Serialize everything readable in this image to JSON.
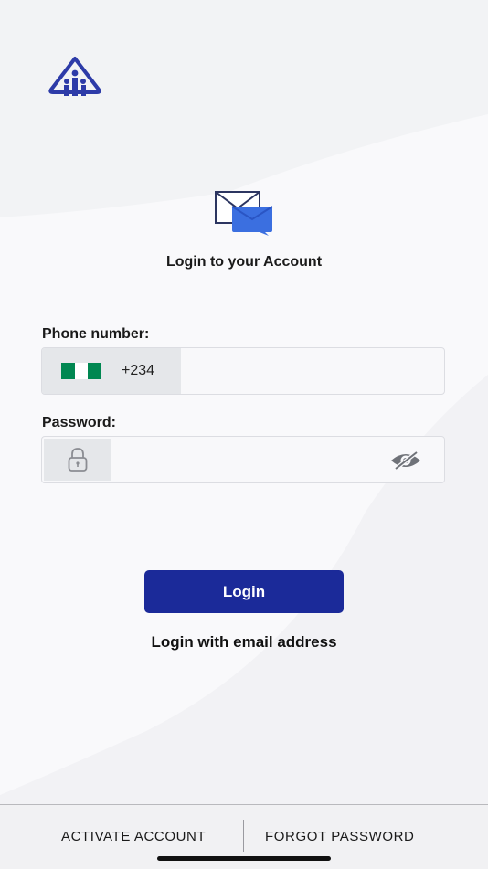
{
  "header": {
    "logo_icon": "app-logo-icon",
    "mail_icon": "envelope-chat-icon",
    "title": "Login to your Account"
  },
  "phone": {
    "label": "Phone number:",
    "country_code": "+234",
    "flag_icon": "nigeria-flag-icon",
    "value": "",
    "placeholder": ""
  },
  "password": {
    "label": "Password:",
    "lock_icon": "lock-icon",
    "toggle_icon": "eye-slash-icon",
    "value": ""
  },
  "actions": {
    "login_label": "Login",
    "email_login_label": "Login with email address"
  },
  "footer": {
    "activate_label": "ACTIVATE ACCOUNT",
    "forgot_label": "FORGOT PASSWORD"
  },
  "colors": {
    "primary": "#1b2a99",
    "accent_blue": "#3b6fe0",
    "flag_green": "#008751",
    "background": "#f9f9fb"
  }
}
